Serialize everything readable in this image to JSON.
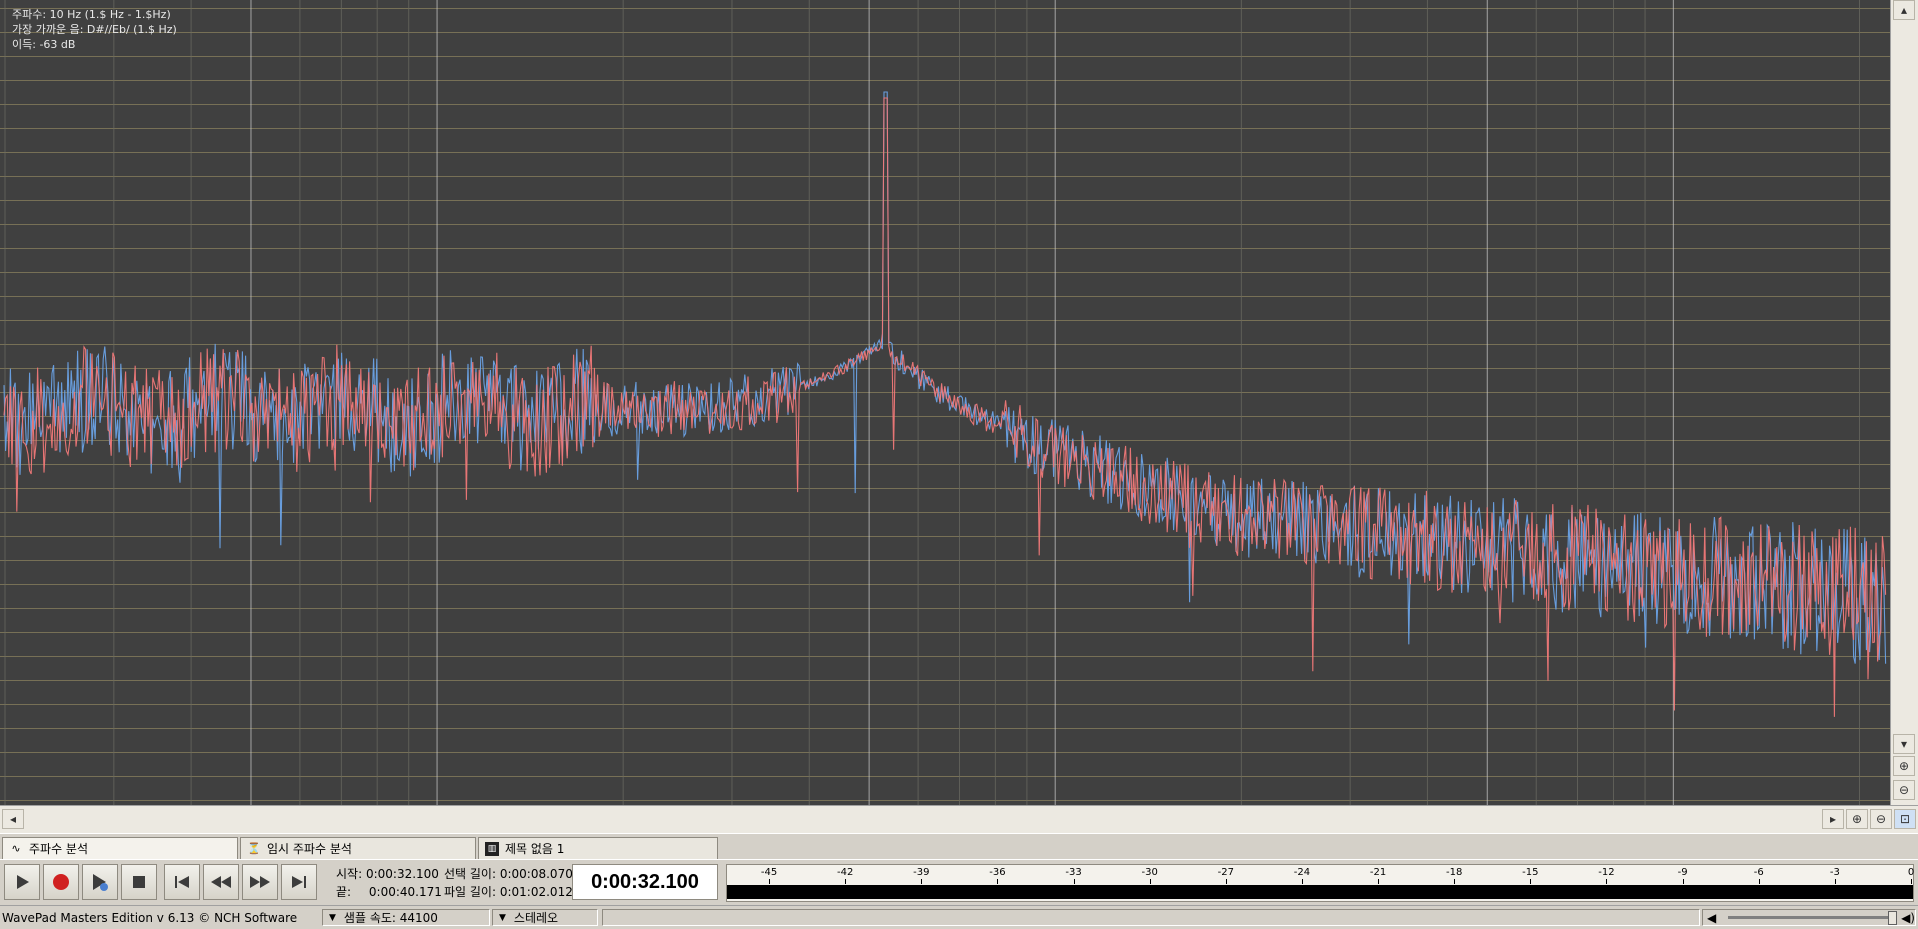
{
  "analysis": {
    "frequency_label": "주파수:",
    "frequency_value": "10 Hz (1.$ Hz - 1.$Hz)",
    "nearest_note_label": "가장 가까운 음:",
    "nearest_note_value": "D#//Eb/ (1.$ Hz)",
    "gain_label": "이득:",
    "gain_value": "-63 dB"
  },
  "tabs": [
    {
      "label": "주파수 분석",
      "icon": "frequency-analysis-icon"
    },
    {
      "label": "임시 주파수 분석",
      "icon": "temporary-frequency-analysis-icon"
    },
    {
      "label": "제목 없음 1",
      "icon": "waveform-file-icon"
    }
  ],
  "transport": {
    "start_label": "시작:",
    "start_value": "0:00:32.100",
    "end_label": "끝:",
    "end_value": "0:00:40.171",
    "selection_label": "선택 길이:",
    "selection_value": "0:00:08.070",
    "file_label": "파일 길이:",
    "file_value": "0:01:02.012",
    "clock": "0:00:32.100",
    "buttons": [
      "play",
      "record",
      "scrub",
      "stop",
      "go-to-start",
      "rewind",
      "fast-forward",
      "go-to-end"
    ]
  },
  "meter": {
    "labels": [
      "-45",
      "-42",
      "-39",
      "-36",
      "-33",
      "-30",
      "-27",
      "-24",
      "-21",
      "-18",
      "-15",
      "-12",
      "-9",
      "-6",
      "-3",
      "0"
    ],
    "min": -46.5,
    "max": 0
  },
  "status": {
    "app": "WavePad Masters Edition v 6.13 © NCH Software",
    "sample_rate": "샘플 속도: 44100",
    "channels": "스테레오"
  },
  "colors": {
    "plot_bg": "#404040",
    "grid_major": "#c8b878",
    "grid_minor": "#6a6a62",
    "left_channel": "#6aa2e6",
    "right_channel": "#f07878"
  }
}
